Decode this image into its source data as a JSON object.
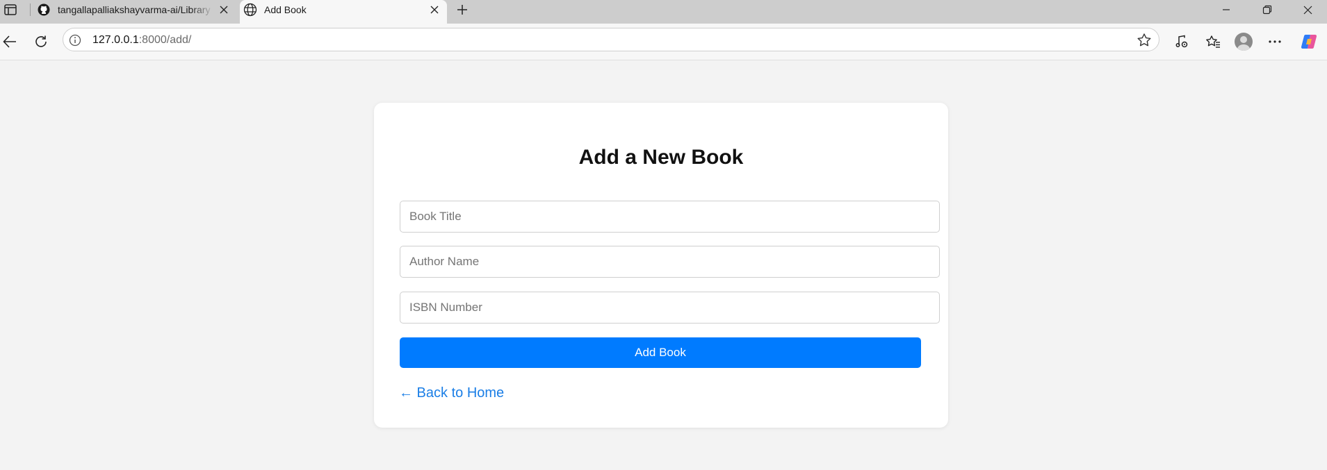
{
  "browser": {
    "tabs": [
      {
        "title": "tangallapalliakshayvarma-ai/Library",
        "icon": "github-icon",
        "active": false
      },
      {
        "title": "Add Book",
        "icon": "globe-icon",
        "active": true
      }
    ],
    "address": {
      "host": "127.0.0.1",
      "rest": ":8000/add/"
    }
  },
  "page": {
    "heading": "Add a New Book",
    "fields": {
      "title_placeholder": "Book Title",
      "author_placeholder": "Author Name",
      "isbn_placeholder": "ISBN Number"
    },
    "submit_label": "Add Book",
    "back_link": "← Back to Home"
  },
  "colors": {
    "primary_button": "#007bff",
    "link": "#1a7ee6",
    "page_bg": "#f3f3f3"
  }
}
